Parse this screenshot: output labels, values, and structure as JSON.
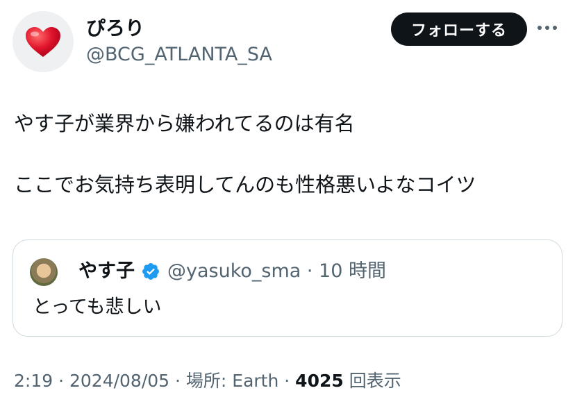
{
  "author": {
    "display_name": "ぴろり",
    "handle": "@BCG_ATLANTA_SA",
    "avatar_icon": "heart-icon"
  },
  "actions": {
    "follow_label": "フォローする",
    "more_icon": "more-dots-icon"
  },
  "tweet": {
    "line1": "やす子が業界から嫌われてるのは有名",
    "line2": "ここでお気持ち表明してんのも性格悪いよなコイツ"
  },
  "quote": {
    "name": "やす子",
    "verified_icon": "verified-badge-icon",
    "handle_time": "@yasuko_sma · 10 時間",
    "text": "とっても悲しい"
  },
  "meta": {
    "time_date": "2:19 · 2024/08/05 · 場所: Earth · ",
    "views": "4025",
    "views_label": " 回表示"
  },
  "colors": {
    "text": "#0f1419",
    "secondary": "#536471",
    "border": "#cfd9de",
    "verified": "#1d9bf0",
    "heart": "#e0142b"
  }
}
